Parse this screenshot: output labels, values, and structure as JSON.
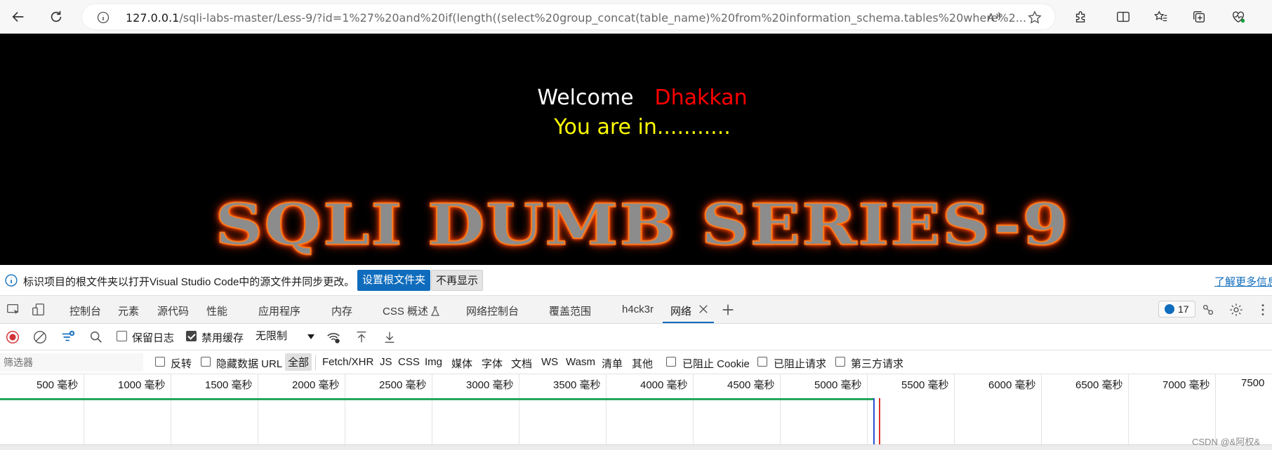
{
  "browser": {
    "url_host": "127.0.0.1",
    "url_rest": "/sqli-labs-master/Less-9/?id=1%27%20and%20if(length((select%20group_concat(table_name)%20from%20information_schema.tables%20where%2..."
  },
  "page": {
    "welcome": "Welcome",
    "name": "Dhakkan",
    "status": "You are in...........",
    "banner": "SQLI DUMB SERIES-9"
  },
  "infobar": {
    "message": "标识项目的根文件夹以打开Visual Studio Code中的源文件并同步更改。",
    "set_root_button": "设置根文件夹",
    "dont_show_button": "不再显示",
    "learn_more": "了解更多信息"
  },
  "devtools": {
    "tabs": [
      "控制台",
      "元素",
      "源代码",
      "性能",
      "应用程序",
      "内存",
      "CSS 概述",
      "网络控制台",
      "覆盖范围",
      "h4ck3r",
      "网络"
    ],
    "active_tab": "网络",
    "issue_count": "17"
  },
  "network_toolbar": {
    "preserve_log": "保留日志",
    "disable_cache": "禁用缓存",
    "throttle": "无限制"
  },
  "filter_row": {
    "placeholder": "筛选器",
    "invert": "反转",
    "hide_data_urls": "隐藏数据 URL",
    "types": [
      "全部",
      "Fetch/XHR",
      "JS",
      "CSS",
      "Img",
      "媒体",
      "字体",
      "文档",
      "WS",
      "Wasm",
      "清单",
      "其他"
    ],
    "blocked_cookies": "已阻止 Cookie",
    "blocked_requests": "已阻止请求",
    "third_party": "第三方请求"
  },
  "timeline": {
    "ticks": [
      "500  毫秒",
      "1000  毫秒",
      "1500  毫秒",
      "2000  毫秒",
      "2500  毫秒",
      "3000  毫秒",
      "3500  毫秒",
      "4000  毫秒",
      "4500  毫秒",
      "5000  毫秒",
      "5500  毫秒",
      "6000  毫秒",
      "6500  毫秒",
      "7000  毫秒",
      "7500"
    ]
  },
  "watermark": "CSDN @&阿权&",
  "colors": {
    "accent": "#0f6cbd",
    "welcome": "#ffffff",
    "name": "#ff0000",
    "status": "#ffff00",
    "banner_glow": "#ff5500",
    "timeline_green": "#26a65b",
    "dom_content_loaded": "#2b4fd6",
    "load": "#e0302b"
  }
}
